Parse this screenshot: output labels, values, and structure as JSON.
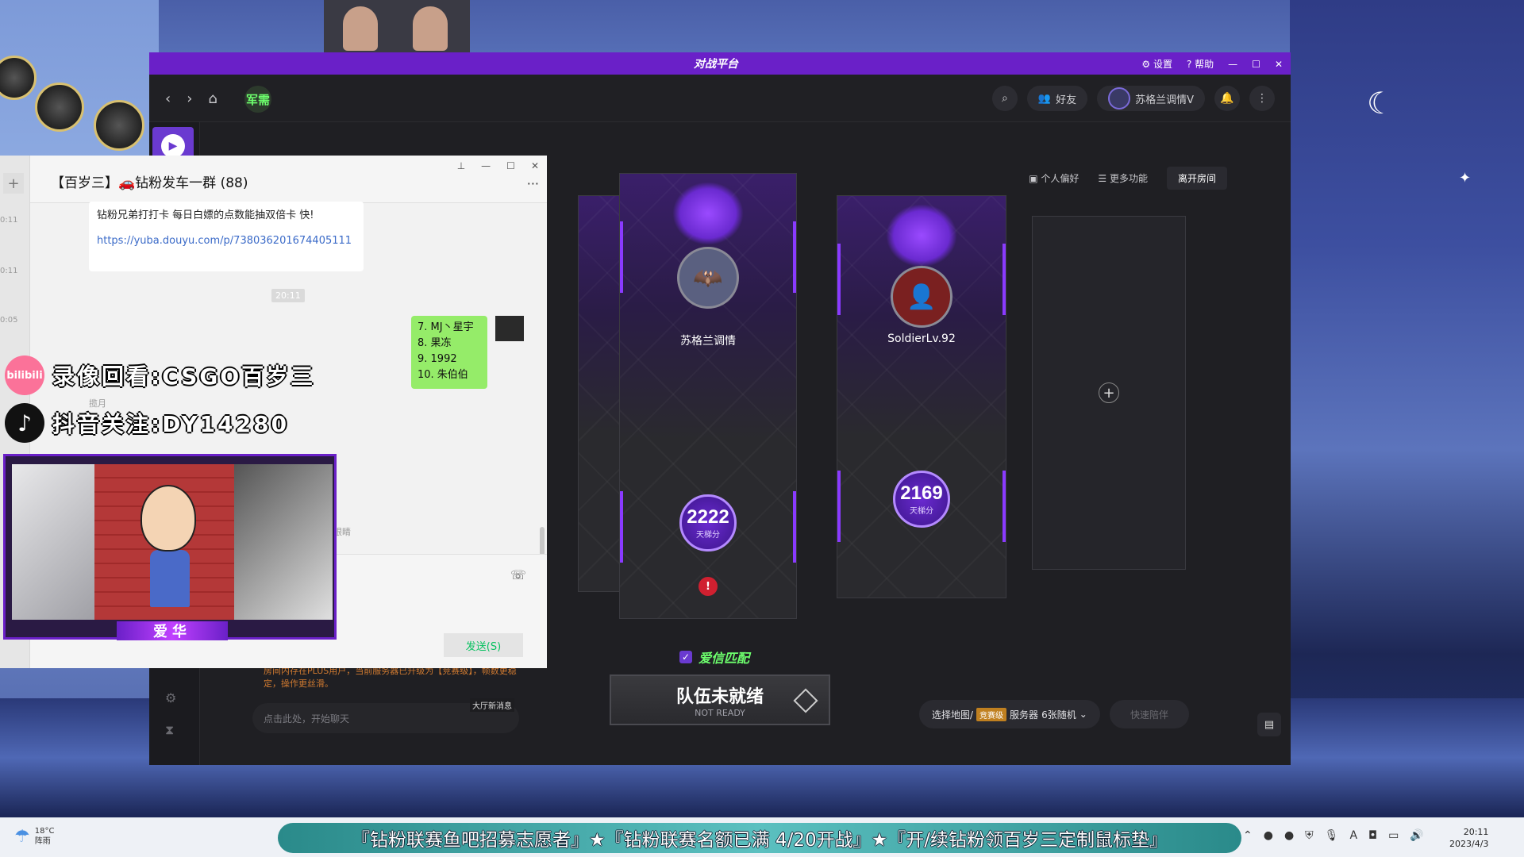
{
  "game_window": {
    "logo": "对战平台",
    "titlebar": {
      "settings": "设置",
      "help": "帮助"
    },
    "nav": {
      "junxu": "军需",
      "friends": "好友",
      "username": "苏格兰调情V"
    },
    "room_tools": {
      "preference": "个人偏好",
      "more": "更多功能",
      "leave": "离开房间"
    },
    "players": [
      {
        "name": "苏格兰调情",
        "score": "2222",
        "score_label": "天梯分"
      },
      {
        "name": "SoldierLv.92",
        "score": "2169",
        "score_label": "天梯分"
      }
    ],
    "trust_match": "爱信匹配",
    "ready": {
      "cn": "队伍未就绪",
      "en": "NOT READY"
    },
    "map_select": {
      "label": "选择地图/",
      "tag": "竞赛级",
      "server": "服务器",
      "maps": "6张随机"
    },
    "quick": "快速陪伴",
    "notice": "房间内存在PLUS用户，当前服务器已升级为【竞赛级】，帧数更稳定，操作更丝滑。",
    "chat_placeholder": "点击此处，开始聊天",
    "hall_msg": "大厅新消息"
  },
  "chat_window": {
    "title": "【百岁三】🚗钻粉发车一群 (88)",
    "left_labels": [
      "0:11",
      "0:11",
      "0:05"
    ],
    "msg1_text": "钻粉兄弟打打卡 每日白嫖的点数能抽双倍卡 快!",
    "msg1_link": "https://yuba.douyu.com/p/738036201674405111",
    "time": "20:11",
    "msg2_lines": [
      "7. MJ丶星宇",
      "8. 果冻",
      "9. 1992",
      "10. 朱伯伯"
    ],
    "sender": "揽月",
    "faded": "眼睛",
    "send": "发送(S)"
  },
  "overlays": {
    "bili_icon": "bilibili",
    "bili_text": "录像回看:CSGO百岁三",
    "douyin_text": "抖音关注:DY14280",
    "cam_name": "爱华"
  },
  "taskbar": {
    "temp": "18°C",
    "weather": "阵雨",
    "marquee": "『钻粉联赛鱼吧招募志愿者』★『钻粉联赛名额已满 4/20开战』★『开/续钻粉领百岁三定制鼠标垫』",
    "time": "20:11",
    "date": "2023/4/3"
  }
}
